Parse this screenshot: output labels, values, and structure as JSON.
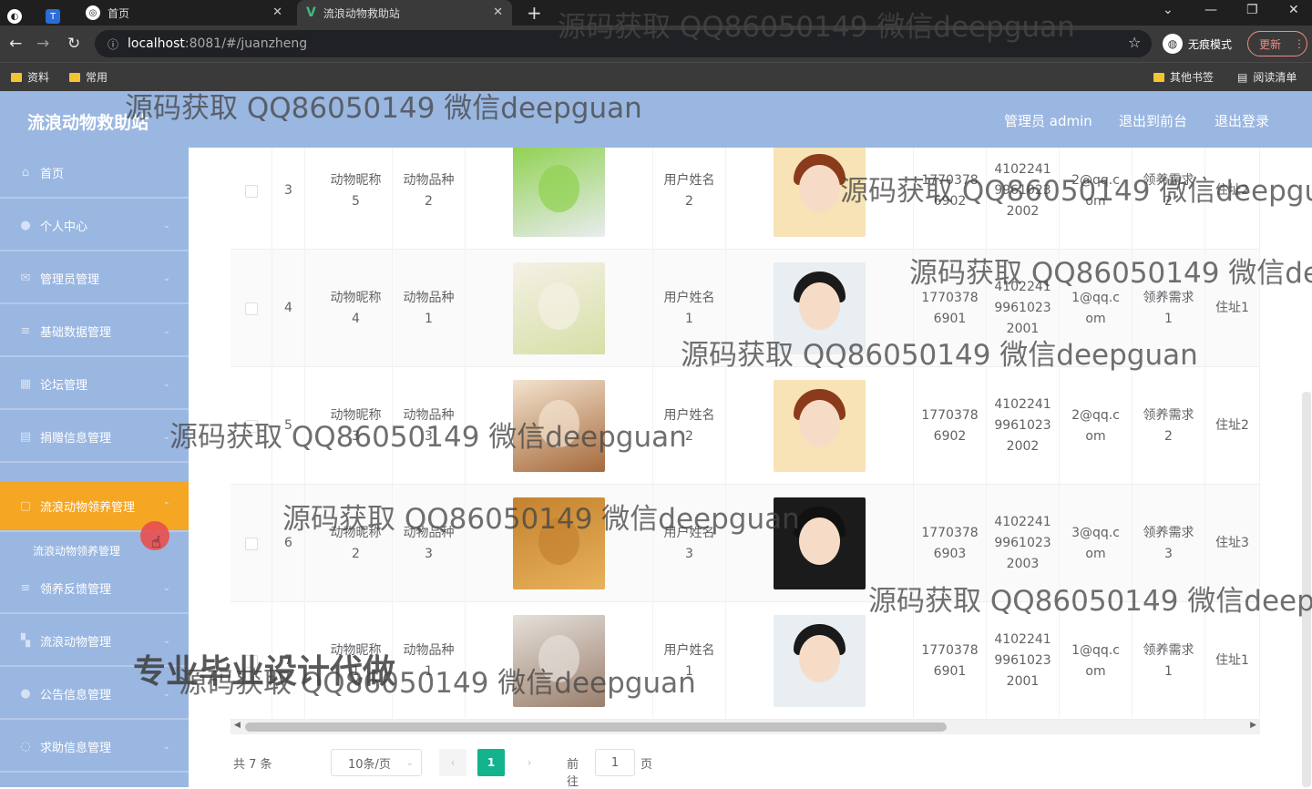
{
  "browser": {
    "tabs": [
      {
        "title": "首页"
      },
      {
        "title": "流浪动物救助站"
      }
    ],
    "url_host": "localhost",
    "url_rest": ":8081/#/juanzheng",
    "incognito_label": "无痕模式",
    "update_label": "更新",
    "bookmarks": [
      "资料",
      "常用"
    ],
    "other_bookmarks": "其他书签",
    "reading_list": "阅读清单"
  },
  "header": {
    "title": "流浪动物救助站",
    "admin": "管理员 admin",
    "to_front": "退出到前台",
    "logout": "退出登录"
  },
  "sidebar": {
    "items": [
      {
        "label": "首页"
      },
      {
        "label": "个人中心"
      },
      {
        "label": "管理员管理"
      },
      {
        "label": "基础数据管理"
      },
      {
        "label": "论坛管理"
      },
      {
        "label": "捐赠信息管理"
      },
      {
        "label": "流浪动物领养管理"
      },
      {
        "label": "领养反馈管理"
      },
      {
        "label": "流浪动物管理"
      },
      {
        "label": "公告信息管理"
      },
      {
        "label": "求助信息管理"
      }
    ],
    "submenu": "流浪动物领养管理"
  },
  "table": {
    "rows": [
      {
        "index": "3",
        "name": "动物昵称\n5",
        "breed": "动物品种\n2",
        "user": "用户姓名\n2",
        "phone": "1770378\n6902",
        "id": "4102241\n9961023\n2002",
        "email": "2@qq.c\nom",
        "need": "领养需求\n2",
        "addr": "住址2"
      },
      {
        "index": "4",
        "name": "动物昵称\n4",
        "breed": "动物品种\n1",
        "user": "用户姓名\n1",
        "phone": "1770378\n6901",
        "id": "4102241\n9961023\n2001",
        "email": "1@qq.c\nom",
        "need": "领养需求\n1",
        "addr": "住址1"
      },
      {
        "index": "5",
        "name": "动物昵称\n3",
        "breed": "动物品种\n3",
        "user": "用户姓名\n2",
        "phone": "1770378\n6902",
        "id": "4102241\n9961023\n2002",
        "email": "2@qq.c\nom",
        "need": "领养需求\n2",
        "addr": "住址2"
      },
      {
        "index": "6",
        "name": "动物昵称\n2",
        "breed": "动物品种\n3",
        "user": "用户姓名\n3",
        "phone": "1770378\n6903",
        "id": "4102241\n9961023\n2003",
        "email": "3@qq.c\nom",
        "need": "领养需求\n3",
        "addr": "住址3"
      },
      {
        "index": "7",
        "name": "动物昵称\n1",
        "breed": "动物品种\n1",
        "user": "用户姓名\n1",
        "phone": "1770378\n6901",
        "id": "4102241\n9961023\n2001",
        "email": "1@qq.c\nom",
        "need": "领养需求\n1",
        "addr": "住址1"
      }
    ]
  },
  "pagination": {
    "total": "共 7 条",
    "page_size": "10条/页",
    "current": "1",
    "goto_label": "前往",
    "goto_value": "1",
    "page_suffix": "页"
  },
  "watermark": {
    "text": "源码获取 QQ86050149 微信deepguan",
    "promo": "专业毕业设计代做"
  },
  "colors": {
    "primary": "#9ab7e1",
    "active": "#f5a623",
    "pager_active": "#13b38e"
  }
}
